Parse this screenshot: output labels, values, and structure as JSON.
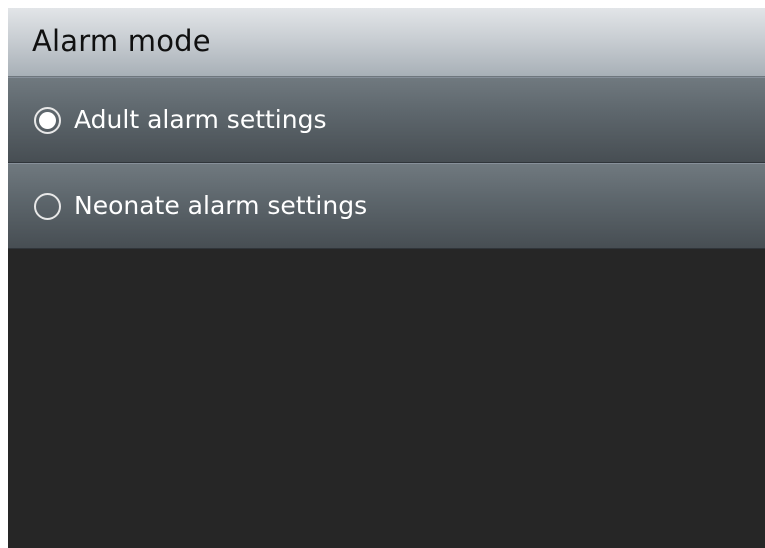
{
  "title": "Alarm mode",
  "options": [
    {
      "label": "Adult alarm settings",
      "selected": true
    },
    {
      "label": "Neonate alarm settings",
      "selected": false
    }
  ],
  "colors": {
    "background": "#262626",
    "title_bar": "#c9ced3",
    "option_row": "#5e676d",
    "text_light": "#ffffff",
    "text_dark": "#101010"
  },
  "icons": {
    "selected": "radio-selected-icon",
    "unselected": "radio-unselected-icon"
  }
}
